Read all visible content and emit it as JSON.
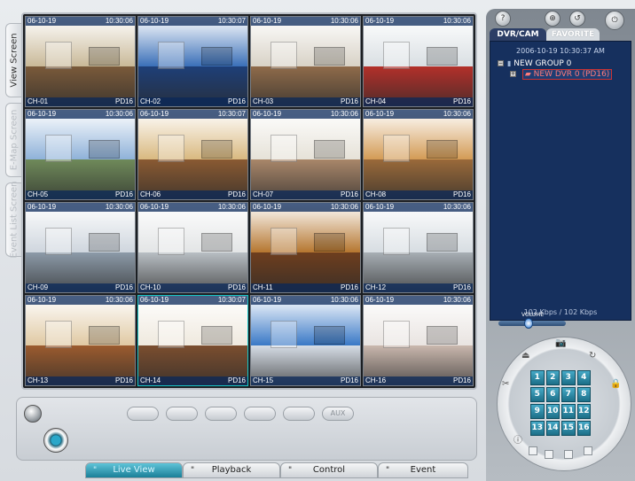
{
  "left_tabs": [
    "View Screen",
    "E-Map Screen",
    "Event List Screen"
  ],
  "cameras": [
    {
      "date": "06-10-19",
      "time": "10:30:06",
      "ch": "CH-01",
      "src": "PD16",
      "wall": "#c9b998",
      "floor": "#7a5a3a"
    },
    {
      "date": "06-10-19",
      "time": "10:30:07",
      "ch": "CH-02",
      "src": "PD16",
      "wall": "#3a6fb8",
      "floor": "#1e3f78"
    },
    {
      "date": "06-10-19",
      "time": "10:30:06",
      "ch": "CH-03",
      "src": "PD16",
      "wall": "#d8d2c6",
      "floor": "#8f6b4a"
    },
    {
      "date": "06-10-19",
      "time": "10:30:06",
      "ch": "CH-04",
      "src": "PD16",
      "wall": "#d9dfe3",
      "floor": "#b3302a"
    },
    {
      "date": "06-10-19",
      "time": "10:30:06",
      "ch": "CH-05",
      "src": "PD16",
      "wall": "#8fb2d9",
      "floor": "#6f8a5a"
    },
    {
      "date": "06-10-19",
      "time": "10:30:07",
      "ch": "CH-06",
      "src": "PD16",
      "wall": "#d9b980",
      "floor": "#8a5a32"
    },
    {
      "date": "06-10-19",
      "time": "10:30:06",
      "ch": "CH-07",
      "src": "PD16",
      "wall": "#e6e2d8",
      "floor": "#a9876a"
    },
    {
      "date": "06-10-19",
      "time": "10:30:06",
      "ch": "CH-08",
      "src": "PD16",
      "wall": "#d39b55",
      "floor": "#9a6a3a"
    },
    {
      "date": "06-10-19",
      "time": "10:30:06",
      "ch": "CH-09",
      "src": "PD16",
      "wall": "#cfd6de",
      "floor": "#8c9aa8"
    },
    {
      "date": "06-10-19",
      "time": "10:30:06",
      "ch": "CH-10",
      "src": "PD16",
      "wall": "#e3e5e6",
      "floor": "#b8bec3"
    },
    {
      "date": "06-10-19",
      "time": "10:30:06",
      "ch": "CH-11",
      "src": "PD16",
      "wall": "#b5762f",
      "floor": "#6e3e1e"
    },
    {
      "date": "06-10-19",
      "time": "10:30:06",
      "ch": "CH-12",
      "src": "PD16",
      "wall": "#d7dde2",
      "floor": "#a7aeb4"
    },
    {
      "date": "06-10-19",
      "time": "10:30:06",
      "ch": "CH-13",
      "src": "PD16",
      "wall": "#e0c9a3",
      "floor": "#9b5b2e"
    },
    {
      "date": "06-10-19",
      "time": "10:30:07",
      "ch": "CH-14",
      "src": "PD16",
      "wall": "#efe9de",
      "floor": "#7b4e2f"
    },
    {
      "date": "06-10-19",
      "time": "10:30:06",
      "ch": "CH-15",
      "src": "PD16",
      "wall": "#3978c6",
      "floor": "#d6dde6"
    },
    {
      "date": "06-10-19",
      "time": "10:30:06",
      "ch": "CH-16",
      "src": "PD16",
      "wall": "#e9e4e1",
      "floor": "#c9b7ad"
    }
  ],
  "control_buttons": [
    "",
    "",
    "",
    "",
    "",
    "AUX"
  ],
  "bottom_tabs": [
    "Live View",
    "Playback",
    "Control",
    "Event"
  ],
  "panel": {
    "tab_active": "DVR/CAM",
    "tab_inactive": "FAVORITE",
    "timestamp": "2006-10-19 10:30:37 AM",
    "group_label": "NEW GROUP 0",
    "dvr_label": "NEW DVR 0 (PD16)",
    "rate": "102 Kbps / 102 Kbps",
    "volume_label": "VOLUME",
    "volume_level": 0.45,
    "top_icons": [
      "?",
      "⊕",
      "↺",
      "⏻"
    ]
  },
  "keypad": [
    "1",
    "2",
    "3",
    "4",
    "5",
    "6",
    "7",
    "8",
    "9",
    "10",
    "11",
    "12",
    "13",
    "14",
    "15",
    "16"
  ]
}
